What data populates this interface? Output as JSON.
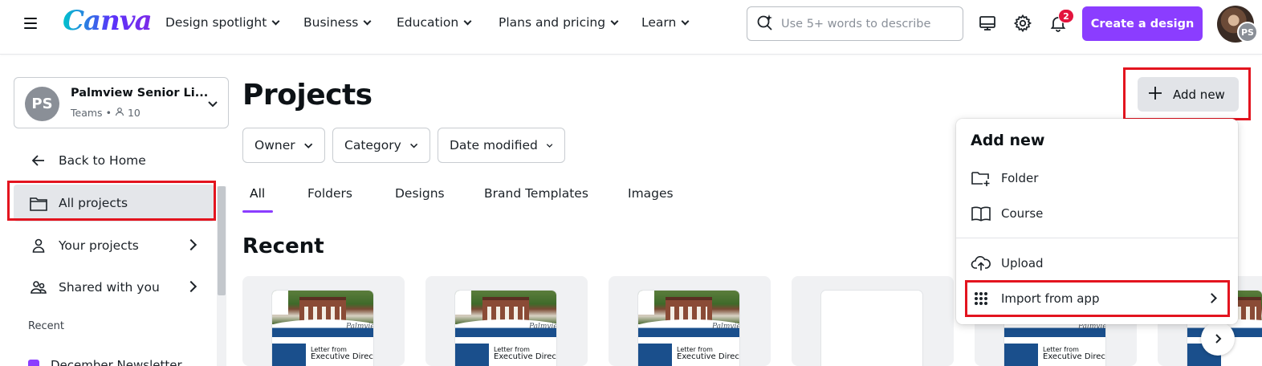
{
  "nav": {
    "logo": "Canva",
    "items": [
      {
        "label": "Design spotlight"
      },
      {
        "label": "Business"
      },
      {
        "label": "Education"
      },
      {
        "label": "Plans and pricing"
      },
      {
        "label": "Learn"
      }
    ],
    "search_placeholder": "Use 5+ words to describe",
    "notification_count": "2",
    "create_label": "Create a design",
    "avatar_initials": "PS"
  },
  "sidebar": {
    "team_initials": "PS",
    "team_name": "Palmview Senior Li...",
    "team_type": "Teams",
    "team_members": "10",
    "back_label": "Back to Home",
    "items": [
      {
        "label": "All projects"
      },
      {
        "label": "Your projects"
      },
      {
        "label": "Shared with you"
      }
    ],
    "recent_heading": "Recent",
    "recent_first": "December Newsletter"
  },
  "main": {
    "title": "Projects",
    "filters": [
      {
        "label": "Owner"
      },
      {
        "label": "Category"
      },
      {
        "label": "Date modified"
      }
    ],
    "tabs": [
      {
        "label": "All"
      },
      {
        "label": "Folders"
      },
      {
        "label": "Designs"
      },
      {
        "label": "Brand Templates"
      },
      {
        "label": "Images"
      }
    ],
    "recent_title": "Recent",
    "thumb_heading_small": "Letter from",
    "thumb_heading_large": "Executive Director",
    "thumb_script": "Palmview"
  },
  "add_new": {
    "button_label": "Add new",
    "menu_title": "Add new",
    "items": [
      {
        "label": "Folder"
      },
      {
        "label": "Course"
      },
      {
        "label": "Upload"
      },
      {
        "label": "Import from app"
      }
    ]
  },
  "colors": {
    "accent": "#8b3dff",
    "highlight": "#e3141f",
    "badge": "#e3143e"
  }
}
